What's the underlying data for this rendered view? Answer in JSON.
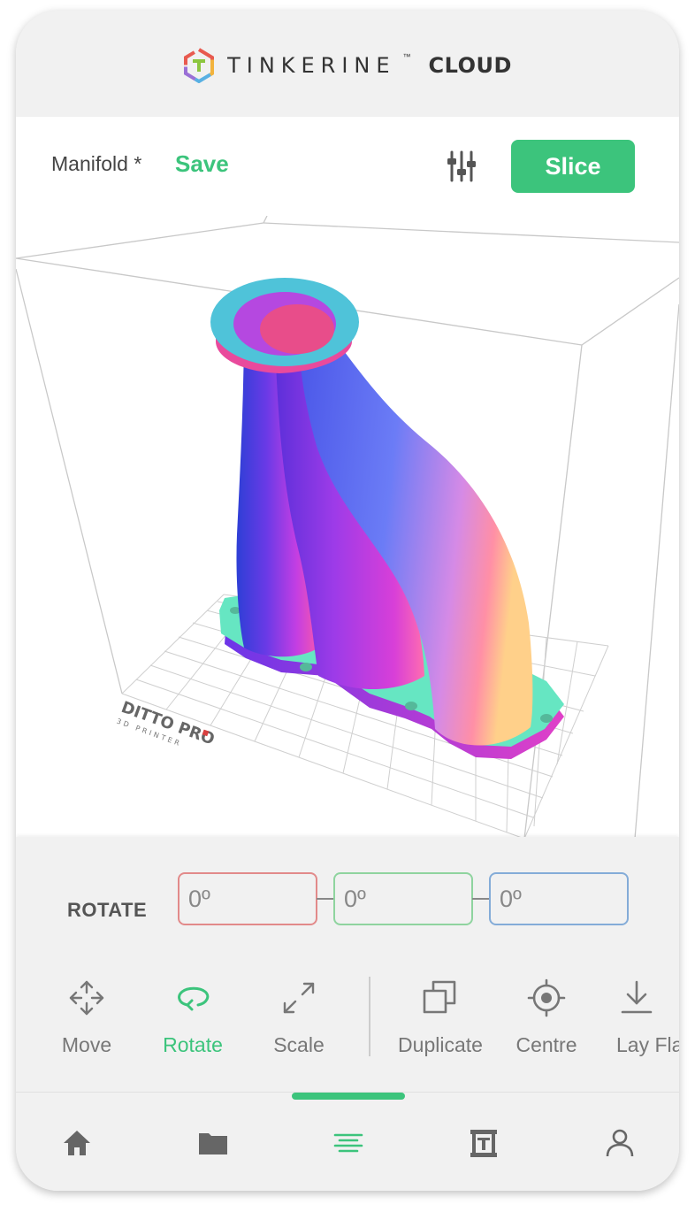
{
  "brand": {
    "name": "TINKERINE",
    "tm": "™",
    "product": "CLOUD"
  },
  "toolbar": {
    "file_name": "Manifold *",
    "save_label": "Save",
    "slice_label": "Slice",
    "settings_icon": "sliders-icon"
  },
  "viewport": {
    "printer_logo": "DITTO PRO",
    "printer_sub": "3D PRINTER"
  },
  "rotate": {
    "label": "ROTATE",
    "x_value": "0º",
    "y_value": "0º",
    "z_value": "0º"
  },
  "tools": [
    {
      "label": "Move",
      "icon": "move-arrows-icon",
      "active": false
    },
    {
      "label": "Rotate",
      "icon": "rotate-icon",
      "active": true
    },
    {
      "label": "Scale",
      "icon": "scale-icon",
      "active": false
    },
    {
      "label": "Duplicate",
      "icon": "duplicate-icon",
      "active": false
    },
    {
      "label": "Centre",
      "icon": "crosshair-icon",
      "active": false
    },
    {
      "label": "Lay Flat",
      "icon": "download-icon",
      "active": false
    }
  ],
  "tabs": [
    {
      "name": "home",
      "icon": "home-icon",
      "active": false
    },
    {
      "name": "files",
      "icon": "folder-icon",
      "active": false
    },
    {
      "name": "editor",
      "icon": "align-center-icon",
      "active": true
    },
    {
      "name": "printer",
      "icon": "printer-icon",
      "active": false
    },
    {
      "name": "account",
      "icon": "user-icon",
      "active": false
    }
  ],
  "colors": {
    "accent": "#3cc47c",
    "axis_x": "#e28a8a",
    "axis_y": "#8fd49f",
    "axis_z": "#84acd8",
    "text": "#555555"
  }
}
